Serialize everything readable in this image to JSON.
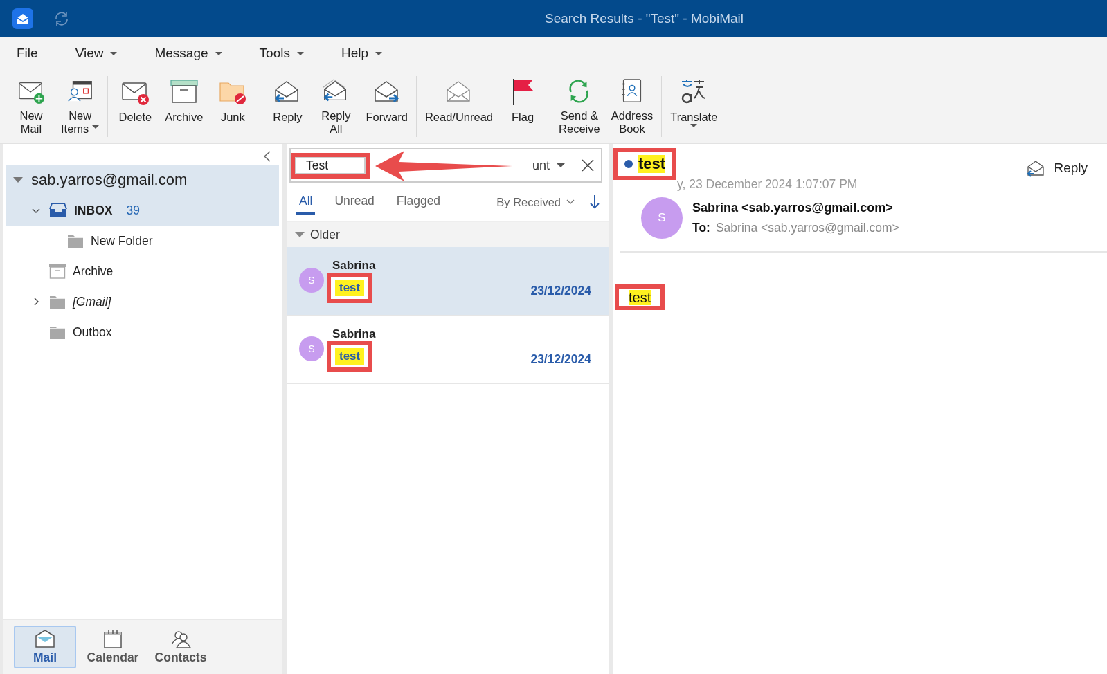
{
  "window": {
    "title": "Search Results - \"Test\" - MobiMail"
  },
  "menu": [
    {
      "label": "File",
      "dropdown": false
    },
    {
      "label": "View",
      "dropdown": true
    },
    {
      "label": "Message",
      "dropdown": true
    },
    {
      "label": "Tools",
      "dropdown": true
    },
    {
      "label": "Help",
      "dropdown": true
    }
  ],
  "toolbar": [
    [
      {
        "kind": "new-mail",
        "lines": [
          "New",
          "Mail"
        ],
        "dropdown": false
      },
      {
        "kind": "new-items",
        "lines": [
          "New",
          "Items"
        ],
        "dropdown": true
      }
    ],
    [
      {
        "kind": "delete",
        "lines": [
          "Delete"
        ],
        "dropdown": false
      },
      {
        "kind": "archive",
        "lines": [
          "Archive"
        ],
        "dropdown": false
      },
      {
        "kind": "junk",
        "lines": [
          "Junk"
        ],
        "dropdown": false
      }
    ],
    [
      {
        "kind": "reply",
        "lines": [
          "Reply"
        ],
        "dropdown": false
      },
      {
        "kind": "reply-all",
        "lines": [
          "Reply",
          "All"
        ],
        "dropdown": false
      },
      {
        "kind": "forward",
        "lines": [
          "Forward"
        ],
        "dropdown": false
      }
    ],
    [
      {
        "kind": "read",
        "lines": [
          "Read/Unread"
        ],
        "dropdown": false
      },
      {
        "kind": "flag",
        "lines": [
          "Flag"
        ],
        "dropdown": false
      }
    ],
    [
      {
        "kind": "sync",
        "lines": [
          "Send &",
          "Receive"
        ],
        "dropdown": false
      },
      {
        "kind": "book",
        "lines": [
          "Address",
          "Book"
        ],
        "dropdown": false
      }
    ],
    [
      {
        "kind": "translate",
        "lines": [
          "Translate"
        ],
        "dropdown": true
      }
    ]
  ],
  "folders": [
    {
      "name": "sab.yarros@gmail.com",
      "kind": "account",
      "expanded": true,
      "selected": true,
      "children": [
        {
          "name": "INBOX",
          "kind": "inbox",
          "count": "39",
          "expanded": true,
          "selected": true,
          "children": [
            {
              "name": "New Folder",
              "kind": "folder",
              "selected": false
            }
          ]
        },
        {
          "name": "Archive",
          "kind": "archive",
          "selected": false
        },
        {
          "name": "[Gmail]",
          "kind": "folder",
          "italic": true,
          "expanded": false,
          "selected": false
        },
        {
          "name": "Outbox",
          "kind": "folder",
          "selected": false
        }
      ]
    }
  ],
  "nav": [
    {
      "label": "Mail",
      "kind": "mail",
      "selected": true
    },
    {
      "label": "Calendar",
      "kind": "calendar",
      "selected": false
    },
    {
      "label": "Contacts",
      "kind": "contacts",
      "selected": false
    }
  ],
  "search": {
    "value": "Test",
    "scope": "unt",
    "annotated": true,
    "arrow": true
  },
  "filters": [
    {
      "label": "All",
      "selected": true
    },
    {
      "label": "Unread",
      "selected": false
    },
    {
      "label": "Flagged",
      "selected": false
    }
  ],
  "sort": {
    "label": "By Received"
  },
  "group": {
    "label": "Older",
    "expanded": true
  },
  "messages": [
    {
      "avatar": "S",
      "sender": "Sabrina",
      "subject": "test",
      "search_match": true,
      "annotated": true,
      "date": "23/12/2024",
      "selected": true
    },
    {
      "avatar": "S",
      "sender": "Sabrina",
      "subject": "test",
      "search_match": true,
      "annotated": true,
      "date": "23/12/2024",
      "selected": false
    }
  ],
  "reader": {
    "unread": true,
    "subject": "test",
    "subject_match": true,
    "subject_annotated": true,
    "reply": "Reply",
    "date": "y, 23 December 2024 1:07:07 PM",
    "avatar": "S",
    "from": "Sabrina <sab.yarros@gmail.com>",
    "to_label": "To:",
    "to": "Sabrina <sab.yarros@gmail.com>",
    "body": "test",
    "body_match": true,
    "body_annotated": true
  }
}
